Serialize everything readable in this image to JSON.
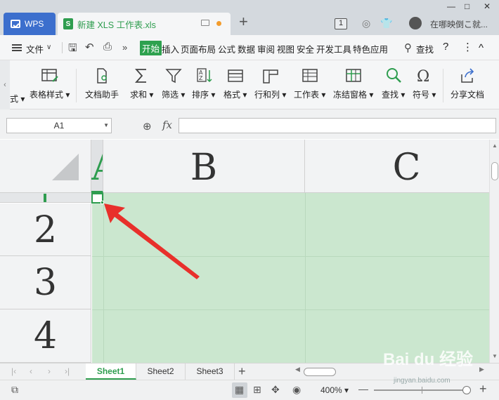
{
  "titlebar": {
    "wps_tab": "WPS",
    "doc_tab_title": "新建 XLS 工作表.xls",
    "doc_icon_letter": "S",
    "new_tab": "+",
    "count_badge": "1",
    "user_text": "在哪映倒こ就...",
    "window_buttons": [
      "—",
      "□",
      "✕"
    ]
  },
  "menubar": {
    "file_menu": "文件",
    "items": [
      "开始",
      "插入",
      "页面布局",
      "公式",
      "数据",
      "审阅",
      "视图",
      "安全",
      "开发工具",
      "特色应用"
    ],
    "active_index": 0,
    "search_label": "查找",
    "help": "?",
    "more": "⋮",
    "collapse": "^"
  },
  "ribbon": {
    "partial_label": "式",
    "buttons": [
      {
        "label": "表格样式",
        "icon": "table-style-icon"
      },
      {
        "label": "文档助手",
        "icon": "doc-assistant-icon"
      },
      {
        "label": "求和",
        "icon": "sum-icon"
      },
      {
        "label": "筛选",
        "icon": "filter-icon"
      },
      {
        "label": "排序",
        "icon": "sort-icon"
      },
      {
        "label": "格式",
        "icon": "format-icon"
      },
      {
        "label": "行和列",
        "icon": "row-col-icon"
      },
      {
        "label": "工作表",
        "icon": "worksheet-icon"
      },
      {
        "label": "冻结窗格",
        "icon": "freeze-panes-icon"
      },
      {
        "label": "查找",
        "icon": "find-icon"
      },
      {
        "label": "符号",
        "icon": "symbol-icon"
      },
      {
        "label": "分享文档",
        "icon": "share-icon"
      }
    ]
  },
  "formulabar": {
    "name_box": "A1",
    "fx": "fx",
    "formula_value": ""
  },
  "grid": {
    "columns": [
      "A",
      "B",
      "C"
    ],
    "rows": [
      "2",
      "3",
      "4"
    ],
    "selected_cell": "A1"
  },
  "sheets": {
    "tabs": [
      "Sheet1",
      "Sheet2",
      "Sheet3"
    ],
    "active_index": 0,
    "add": "+"
  },
  "statusbar": {
    "zoom_level": "400%",
    "zoom_minus": "—",
    "zoom_plus": "+"
  },
  "watermark": {
    "brand": "Bai du 经验",
    "url": "jingyan.baidu.com"
  },
  "colors": {
    "accent_green": "#2e9d4f",
    "wps_blue": "#3c6fcd",
    "selection_fill": "#cbe7cf",
    "arrow_red": "#e8302b"
  }
}
